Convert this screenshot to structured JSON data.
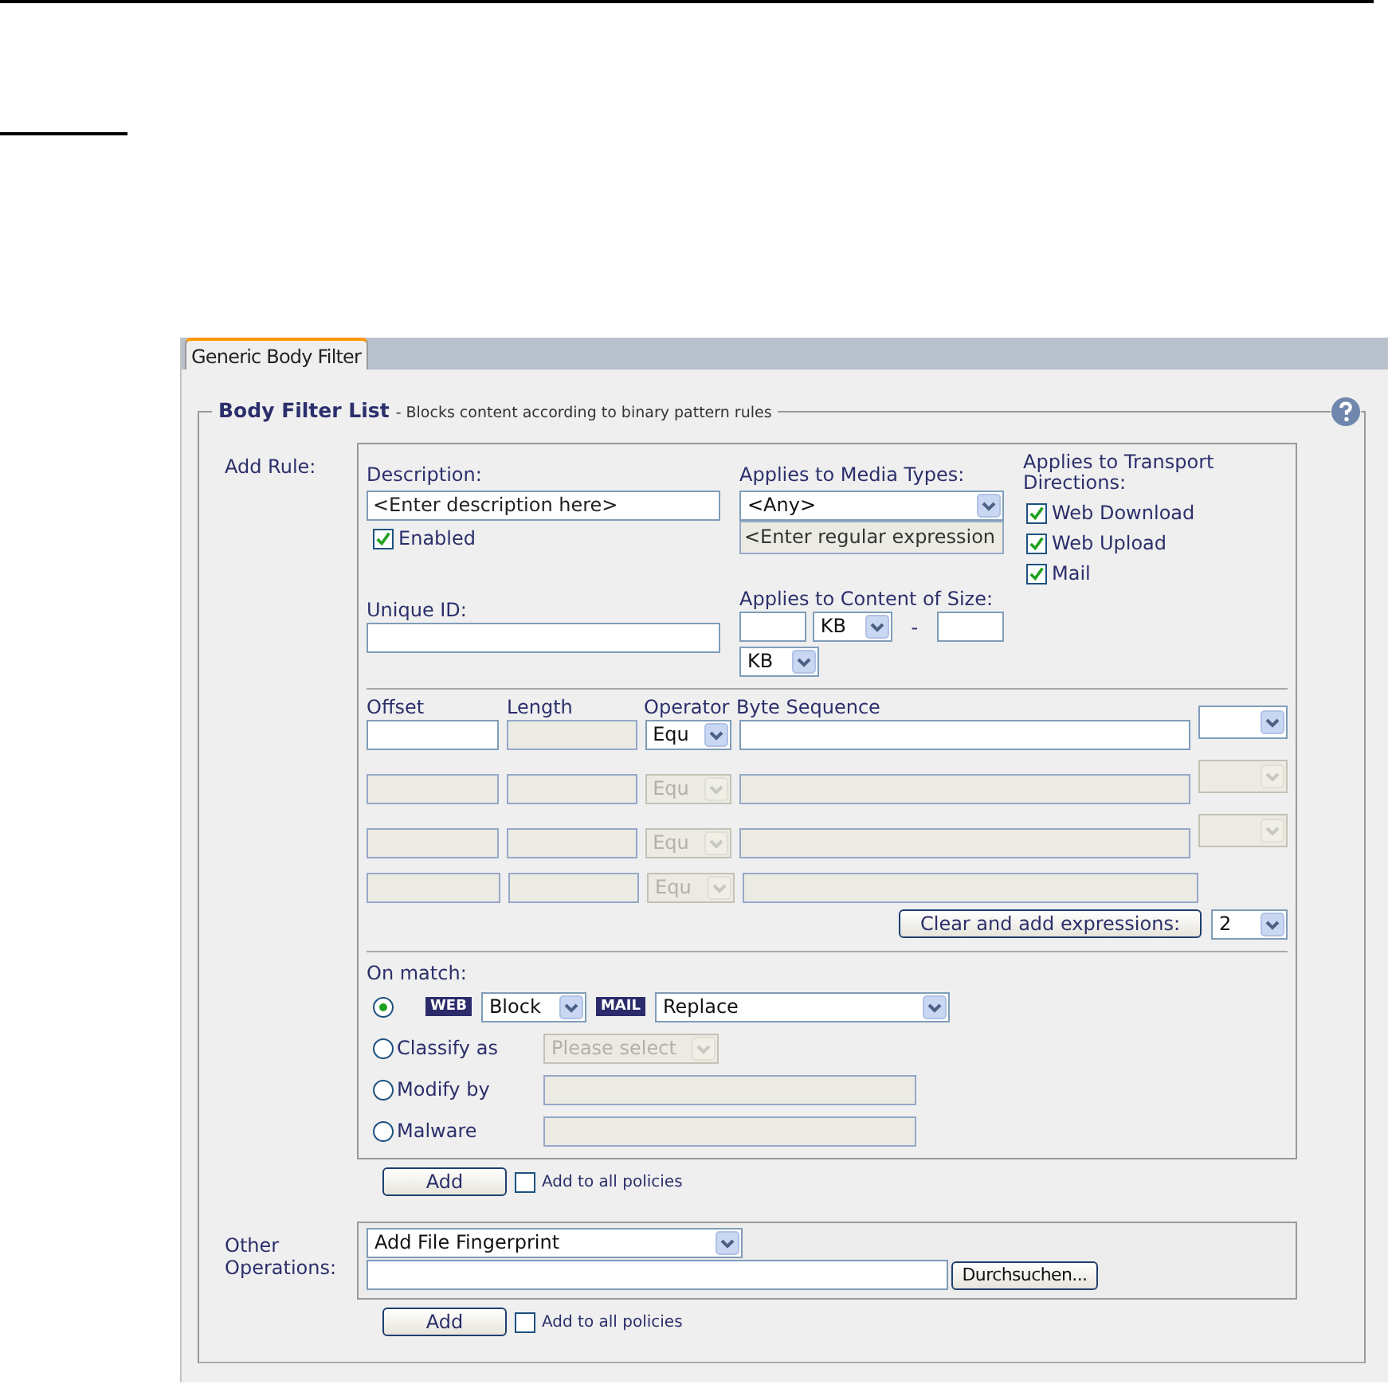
{
  "tab": {
    "label": "Generic Body Filter",
    "selected": true
  },
  "section": {
    "title": "Body Filter List",
    "subtitle": "- Blocks content according to binary pattern rules"
  },
  "add_rule": {
    "label": "Add Rule:",
    "description": {
      "label": "Description:",
      "value": "<Enter description here>"
    },
    "enabled": {
      "label": "Enabled",
      "checked": true
    },
    "unique_id": {
      "label": "Unique ID:"
    },
    "media_types": {
      "label": "Applies to Media Types:",
      "value": "<Any>",
      "regex_value": "<Enter regular expression"
    },
    "size": {
      "label": "Applies to Content of Size:",
      "unit_from": "KB",
      "separator": "-",
      "unit_to": "KB"
    },
    "directions": {
      "label": "Applies to Transport Directions:",
      "items": [
        {
          "label": "Web Download",
          "checked": true
        },
        {
          "label": "Web Upload",
          "checked": true
        },
        {
          "label": "Mail",
          "checked": true
        }
      ]
    },
    "expressions": {
      "columns": [
        "Offset",
        "Length",
        "Operator",
        "Byte Sequence"
      ],
      "rows": [
        {
          "operator": "Equ",
          "disabled": false,
          "connector": true
        },
        {
          "operator": "Equ",
          "disabled": true,
          "connector": true
        },
        {
          "operator": "Equ",
          "disabled": true,
          "connector": true
        },
        {
          "operator": "Equ",
          "disabled": true,
          "connector": false
        }
      ],
      "clear_button": "Clear and add expressions:",
      "count": "2"
    },
    "on_match": {
      "label": "On match:",
      "options": [
        {
          "kind": "actions",
          "selected": true,
          "web_badge": "WEB",
          "web_value": "Block",
          "mail_badge": "MAIL",
          "mail_value": "Replace"
        },
        {
          "kind": "select",
          "selected": false,
          "label": "Classify as",
          "value": "Please select"
        },
        {
          "kind": "field",
          "selected": false,
          "label": "Modify by"
        },
        {
          "kind": "field",
          "selected": false,
          "label": "Malware"
        }
      ]
    },
    "add_button": "Add",
    "add_all": {
      "label": "Add to all policies",
      "checked": false
    }
  },
  "other": {
    "label": "Other Operations:",
    "operation": "Add File Fingerprint",
    "browse_button": "Durchsuchen...",
    "add_button": "Add",
    "add_all": {
      "label": "Add to all policies",
      "checked": false
    }
  }
}
